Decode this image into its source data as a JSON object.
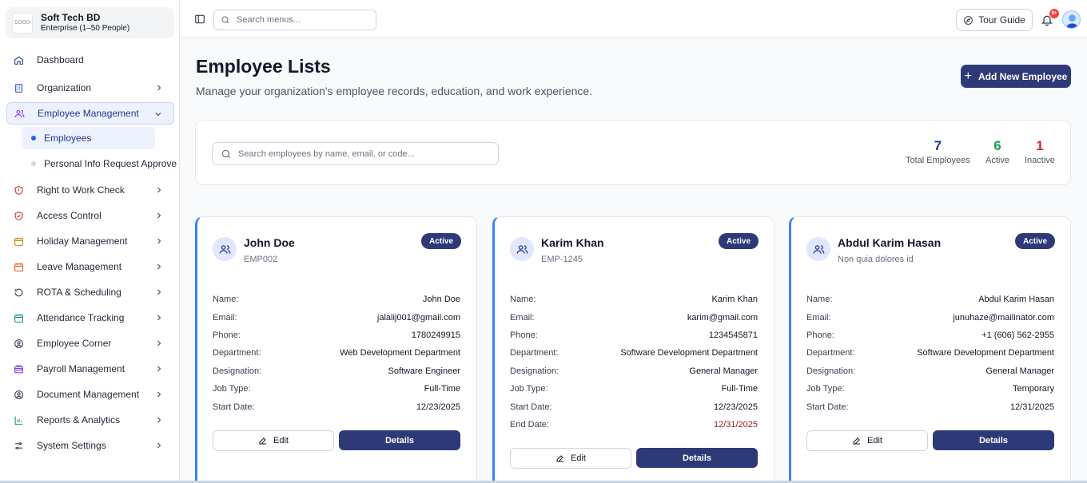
{
  "org": {
    "name": "Soft Tech BD",
    "plan": "Enterprise (1–50 People)"
  },
  "sidebar": {
    "items": [
      {
        "label": "Dashboard",
        "icon": "home-icon"
      },
      {
        "label": "Organization",
        "icon": "building-icon"
      },
      {
        "label": "Employee Management",
        "icon": "users-icon"
      },
      {
        "label": "Right to Work Check",
        "icon": "shield-alert-icon"
      },
      {
        "label": "Access Control",
        "icon": "shield-check-icon"
      },
      {
        "label": "Holiday Management",
        "icon": "calendar-icon"
      },
      {
        "label": "Leave Management",
        "icon": "calendar-icon"
      },
      {
        "label": "ROTA & Scheduling",
        "icon": "rotate-icon"
      },
      {
        "label": "Attendance Tracking",
        "icon": "calendar-grid-icon"
      },
      {
        "label": "Employee Corner",
        "icon": "user-circle-icon"
      },
      {
        "label": "Payroll Management",
        "icon": "wallet-icon"
      },
      {
        "label": "Document Management",
        "icon": "user-circle-icon"
      },
      {
        "label": "Reports & Analytics",
        "icon": "bar-chart-icon"
      },
      {
        "label": "System Settings",
        "icon": "sliders-icon"
      }
    ],
    "sub_items": [
      {
        "label": "Employees"
      },
      {
        "label": "Personal Info Request Approve"
      }
    ]
  },
  "topbar": {
    "search_placeholder": "Search menus...",
    "tour_label": "Tour Guide",
    "notification_badge": "9+"
  },
  "main": {
    "title": "Employee Lists",
    "subtitle": "Manage your organization's employee records, education, and work experience.",
    "add_button": "Add New Employee",
    "search_placeholder": "Search employees by name, email, or code...",
    "stats": [
      {
        "value": "7",
        "label": "Total Employees",
        "color": "#1e3a8a"
      },
      {
        "value": "6",
        "label": "Active",
        "color": "#16a34a"
      },
      {
        "value": "1",
        "label": "Inactive",
        "color": "#dc2626"
      }
    ]
  },
  "labels": {
    "name": "Name:",
    "email": "Email:",
    "phone": "Phone:",
    "department": "Department:",
    "designation": "Designation:",
    "job_type": "Job Type:",
    "start_date": "Start Date:",
    "end_date": "End Date:",
    "edit": "Edit",
    "details": "Details"
  },
  "employees": [
    {
      "name": "John Doe",
      "code": "EMP002",
      "status": "Active",
      "email": "jalalij001@gmail.com",
      "phone": "1780249915",
      "department": "Web Development Department",
      "designation": "Software Engineer",
      "job_type": "Full-Time",
      "start_date": "12/23/2025"
    },
    {
      "name": "Karim Khan",
      "code": "EMP-1245",
      "status": "Active",
      "email": "karim@gmail.com",
      "phone": "1234545871",
      "department": "Software Development Department",
      "designation": "General Manager",
      "job_type": "Full-Time",
      "start_date": "12/23/2025",
      "end_date": "12/31/2025"
    },
    {
      "name": "Abdul Karim Hasan",
      "code": "Non quia dolores id",
      "status": "Active",
      "email": "junuhaze@mailinator.com",
      "phone": "+1 (606) 562-2955",
      "department": "Software Development Department",
      "designation": "General Manager",
      "job_type": "Temporary",
      "start_date": "12/31/2025"
    }
  ]
}
